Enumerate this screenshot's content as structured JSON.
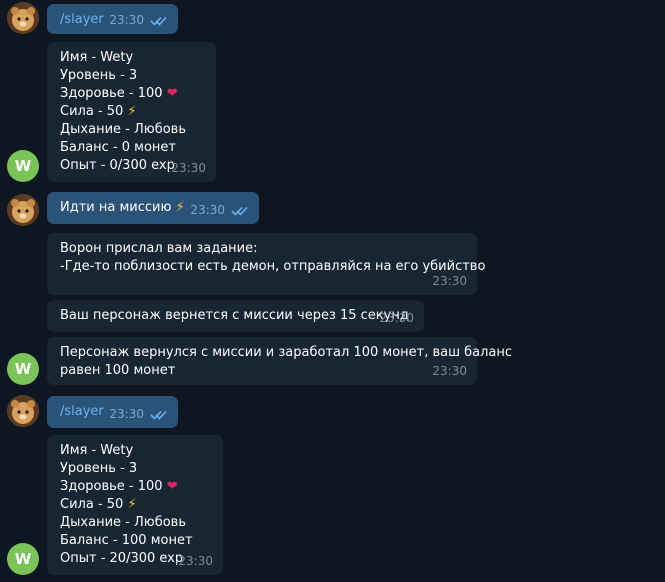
{
  "messages": [
    {
      "from": "user",
      "text": "/slayer",
      "time": "23:30"
    },
    {
      "from": "bot",
      "lines": [
        "Имя - Wety",
        "Уровень - 3",
        "Здоровье - 100",
        "Сила - 50",
        "Дыхание - Любовь",
        "Баланс - 0 монет",
        "Опыт - 0/300 exp"
      ],
      "time": "23:30"
    },
    {
      "from": "user",
      "text": "Идти на миссию",
      "time": "23:30"
    },
    {
      "from": "bot",
      "lines": [
        "Ворон прислал вам задание:",
        "-Где-то поблизости есть демон, отправляйся на его убийство"
      ],
      "time": "23:30"
    },
    {
      "from": "bot",
      "lines": [
        "Ваш персонаж вернется с миссии через 15 секунд"
      ],
      "time": "23:30"
    },
    {
      "from": "bot",
      "lines": [
        "Персонаж вернулся с миссии и заработал 100 монет, ваш баланс",
        "равен 100 монет"
      ],
      "time": "23:30"
    },
    {
      "from": "user",
      "text": "/slayer",
      "time": "23:30"
    },
    {
      "from": "bot",
      "lines": [
        "Имя - Wety",
        "Уровень - 3",
        "Здоровье - 100",
        "Сила - 50",
        "Дыхание - Любовь",
        "Баланс - 100 монет",
        "Опыт - 20/300 exp"
      ],
      "time": "23:30"
    }
  ],
  "bot_avatar_letter": "W",
  "emoji": {
    "heart": "❤",
    "bolt": "⚡"
  },
  "colors": {
    "background": "#0e1621",
    "outgoing": "#2b5278",
    "incoming": "#182533",
    "command": "#6ab3f3",
    "bot_avatar": "#79c357"
  }
}
